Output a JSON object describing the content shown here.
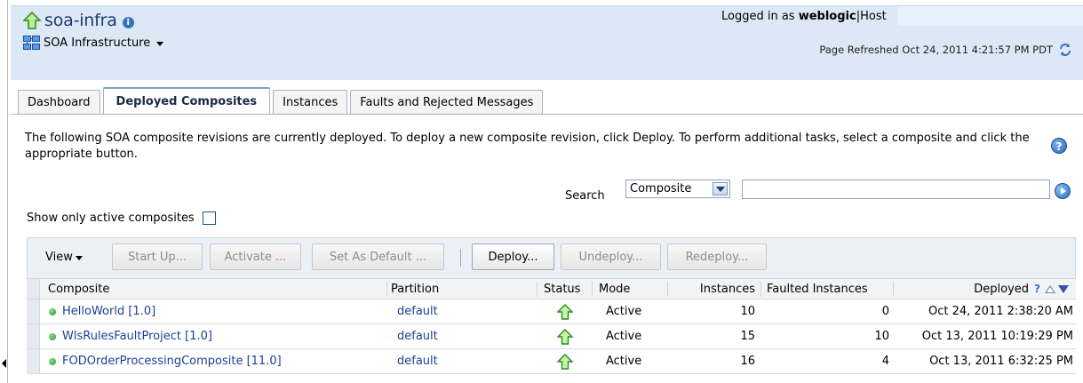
{
  "header": {
    "title": "soa-infra",
    "nav_menu_label": "SOA Infrastructure",
    "logged_in_prefix": "Logged in as",
    "user": "weblogic",
    "host_label": "Host",
    "refresh_text": "Page Refreshed Oct 24, 2011 4:21:57 PM PDT"
  },
  "tabs": [
    {
      "label": "Dashboard",
      "active": false
    },
    {
      "label": "Deployed Composites",
      "active": true
    },
    {
      "label": "Instances",
      "active": false
    },
    {
      "label": "Faults and Rejected Messages",
      "active": false
    }
  ],
  "description": "The following SOA composite revisions are currently deployed. To deploy a new composite revision, click Deploy. To perform additional tasks, select a composite and click the appropriate button.",
  "search": {
    "label": "Search",
    "selected_option": "Composite",
    "value": ""
  },
  "filter": {
    "show_active_label": "Show only active composites",
    "checked": false
  },
  "toolbar": {
    "view_label": "View",
    "start_up": "Start Up...",
    "activate": "Activate ...",
    "set_default": "Set As Default ...",
    "deploy": "Deploy...",
    "undeploy": "Undeploy...",
    "redeploy": "Redeploy..."
  },
  "table": {
    "columns": {
      "composite": "Composite",
      "partition": "Partition",
      "status": "Status",
      "mode": "Mode",
      "instances": "Instances",
      "faulted": "Faulted Instances",
      "deployed": "Deployed"
    },
    "rows": [
      {
        "composite": "HelloWorld [1.0]",
        "partition": "default",
        "mode": "Active",
        "instances": "10",
        "faulted": "0",
        "deployed": "Oct 24, 2011 2:38:20 AM"
      },
      {
        "composite": "WlsRulesFaultProject [1.0]",
        "partition": "default",
        "mode": "Active",
        "instances": "15",
        "faulted": "10",
        "deployed": "Oct 13, 2011 10:19:29 PM"
      },
      {
        "composite": "FODOrderProcessingComposite [11.0]",
        "partition": "default",
        "mode": "Active",
        "instances": "16",
        "faulted": "4",
        "deployed": "Oct 13, 2011 6:32:25 PM"
      }
    ]
  },
  "icons": {
    "app_status": "up-arrow-icon",
    "info": "info-icon",
    "refresh": "refresh-icon",
    "help": "help-icon",
    "go": "go-icon",
    "status": "up-arrow-icon"
  },
  "colors": {
    "header_bg": "#dce8f5",
    "link": "#1c3f94",
    "status_green": "#2c8c2c",
    "toolbar_bg": "#eaf0f6"
  }
}
